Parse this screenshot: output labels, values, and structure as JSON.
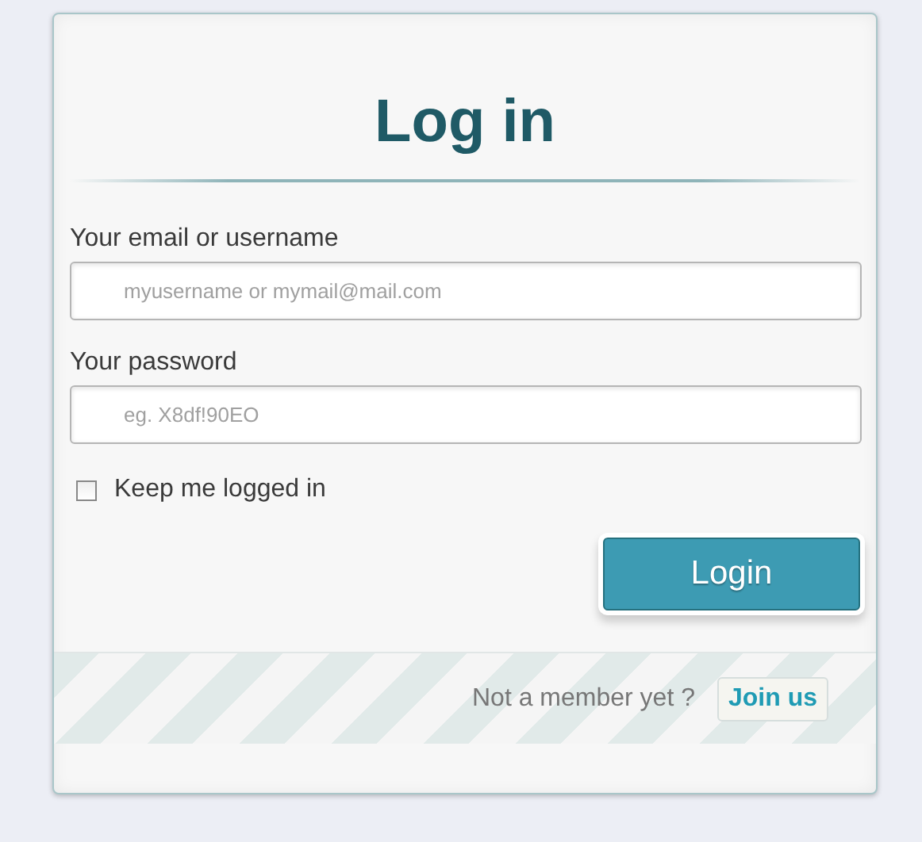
{
  "title": "Log in",
  "fields": [
    {
      "label": "Your email or username",
      "placeholder": "myusername or mymail@mail.com"
    },
    {
      "label": "Your password",
      "placeholder": "eg. X8df!90EO"
    }
  ],
  "remember": {
    "label": "Keep me logged in",
    "checked": false
  },
  "submit": "Login",
  "footer": {
    "text": "Not a member yet ?",
    "link": "Join us"
  }
}
